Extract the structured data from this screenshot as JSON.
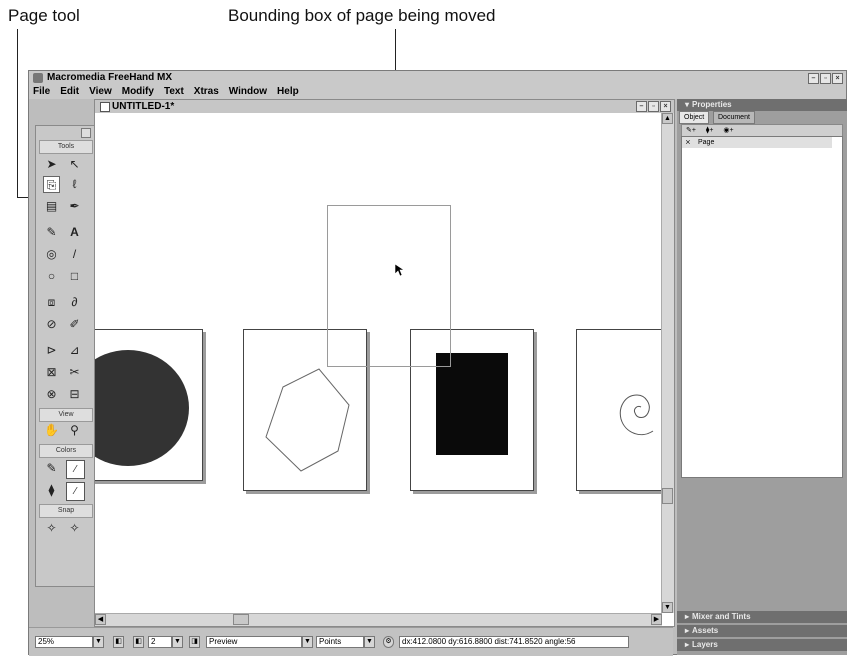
{
  "callouts": {
    "page_tool": "Page tool",
    "bounding_box": "Bounding box of page being moved"
  },
  "app": {
    "title": "Macromedia FreeHand MX",
    "menu": [
      "File",
      "Edit",
      "View",
      "Modify",
      "Text",
      "Xtras",
      "Window",
      "Help"
    ]
  },
  "toolbox": {
    "sections": [
      "Tools",
      "View",
      "Colors",
      "Snap"
    ]
  },
  "document": {
    "title": "UNTITLED-1*"
  },
  "statusbar": {
    "zoom": "25%",
    "page_number": "2",
    "view_mode": "Preview",
    "units": "Points",
    "readout": "dx:412.0800  dy:616.8800  dist:741.8520  angle:56"
  },
  "panels": {
    "properties_title": "Properties",
    "tabs": [
      "Object",
      "Document"
    ],
    "selected_item": "Page",
    "collapsed": [
      "Mixer and Tints",
      "Assets",
      "Layers"
    ]
  },
  "colors": {
    "ellipse_fill": "#333333",
    "rectangle_fill": "#0a0a0a",
    "panel_header": "#6f6f6f"
  }
}
